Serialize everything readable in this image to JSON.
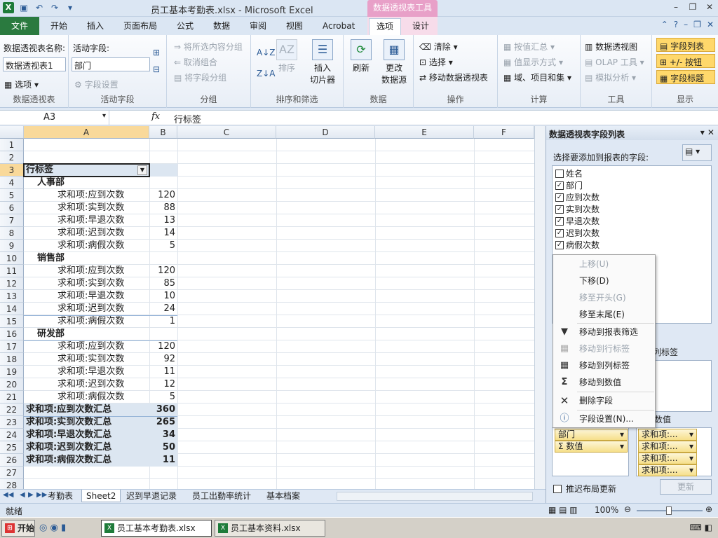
{
  "titlebar": {
    "title": "员工基本考勤表.xlsx - Microsoft Excel",
    "context_tab": "数据透视表工具"
  },
  "tabs": [
    "文件",
    "开始",
    "插入",
    "页面布局",
    "公式",
    "数据",
    "审阅",
    "视图",
    "Acrobat",
    "选项",
    "设计"
  ],
  "ribbon": {
    "pivot_name_label": "数据透视表名称:",
    "pivot_name_value": "数据透视表1",
    "options_btn": "选项",
    "group_pivot": "数据透视表",
    "active_field_label": "活动字段:",
    "active_field_value": "部门",
    "field_settings": "字段设置",
    "group_active": "活动字段",
    "group_sel": "将所选内容分组",
    "ungroup": "取消组合",
    "group_field": "将字段分组",
    "group_group": "分组",
    "sort": "排序",
    "insert_slicer": "插入\n切片器",
    "group_sortfilter": "排序和筛选",
    "refresh": "刷新",
    "change_source": "更改\n数据源",
    "group_data": "数据",
    "clear": "清除",
    "select": "选择",
    "move_pivot": "移动数据透视表",
    "group_actions": "操作",
    "summarize_by": "按值汇总",
    "show_values_as": "值显示方式",
    "fields_items": "域、项目和集",
    "group_calc": "计算",
    "pivot_chart": "数据透视图",
    "olap": "OLAP 工具",
    "what_if": "模拟分析",
    "group_tools": "工具",
    "field_list": "字段列表",
    "buttons": "+/- 按钮",
    "field_headers": "字段标题",
    "group_show": "显示"
  },
  "formula": {
    "namebox": "A3",
    "fx": "fx",
    "value": "行标签"
  },
  "columns": [
    "A",
    "B",
    "C",
    "D",
    "E",
    "F"
  ],
  "rows": [
    "1",
    "2",
    "3",
    "4",
    "5",
    "6",
    "7",
    "8",
    "9",
    "10",
    "11",
    "12",
    "13",
    "14",
    "15",
    "16",
    "17",
    "18",
    "19",
    "20",
    "21",
    "22",
    "23",
    "24",
    "25",
    "26",
    "27",
    "28"
  ],
  "cells": {
    "r3": "行标签",
    "d1": "人事部",
    "d2": "销售部",
    "d3": "研发部",
    "labels": [
      "求和项:应到次数",
      "求和项:实到次数",
      "求和项:早退次数",
      "求和项:迟到次数",
      "求和项:病假次数"
    ],
    "hr": [
      "120",
      "88",
      "13",
      "14",
      "5"
    ],
    "sales": [
      "120",
      "85",
      "10",
      "24",
      "1"
    ],
    "rd": [
      "120",
      "92",
      "11",
      "12",
      "5"
    ],
    "totals_labels": [
      "求和项:应到次数汇总",
      "求和项:实到次数汇总",
      "求和项:早退次数汇总",
      "求和项:迟到次数汇总",
      "求和项:病假次数汇总"
    ],
    "totals": [
      "360",
      "265",
      "34",
      "50",
      "11"
    ]
  },
  "sheet_tabs": [
    "考勤表",
    "Sheet2",
    "迟到早退记录",
    "员工出勤率统计",
    "基本档案"
  ],
  "pane": {
    "title": "数据透视表字段列表",
    "choose": "选择要添加到报表的字段:",
    "fields": [
      {
        "name": "姓名",
        "checked": ""
      },
      {
        "name": "部门",
        "checked": "✓"
      },
      {
        "name": "应到次数",
        "checked": "✓"
      },
      {
        "name": "实到次数",
        "checked": "✓"
      },
      {
        "name": "早退次数",
        "checked": "✓"
      },
      {
        "name": "迟到次数",
        "checked": "✓"
      },
      {
        "name": "病假次数",
        "checked": "✓"
      }
    ],
    "col_label_partial": "列标签",
    "values_partial": "数值",
    "row_chip_1": "部门",
    "row_chip_2": "Σ 数值",
    "value_chips": [
      "求和项:...",
      "求和项:...",
      "求和项:...",
      "求和项:..."
    ],
    "defer": "推迟布局更新",
    "update": "更新"
  },
  "menu": {
    "items": [
      "上移(U)",
      "下移(D)",
      "移至开头(G)",
      "移至末尾(E)",
      "移动到报表筛选",
      "移动到行标签",
      "移动到列标签",
      "移动到数值",
      "删除字段",
      "字段设置(N)..."
    ]
  },
  "status": {
    "ready": "就绪",
    "zoom": "100%"
  },
  "taskbar": {
    "start": "开始",
    "win1": "员工基本考勤表.xlsx",
    "win2": "员工基本资料.xlsx"
  }
}
